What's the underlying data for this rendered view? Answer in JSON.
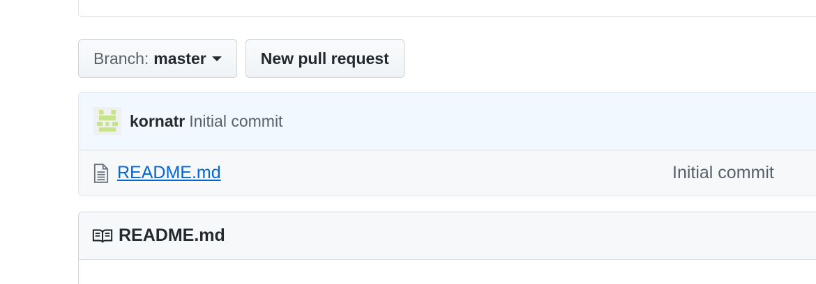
{
  "toolbar": {
    "branch_prefix": "Branch:",
    "branch_name": "master",
    "new_pr_label": "New pull request"
  },
  "commit": {
    "author": "kornatr",
    "message": "Initial commit"
  },
  "files": [
    {
      "name": "README.md",
      "last_commit": "Initial commit"
    }
  ],
  "readme": {
    "title": "README.md"
  },
  "colors": {
    "link": "#0366d6",
    "commit_bar_bg": "#f1f8ff",
    "avatar": "#c6e48b"
  },
  "icons": {
    "file": "file-text-icon",
    "readme": "book-icon",
    "caret": "caret-down-icon"
  }
}
